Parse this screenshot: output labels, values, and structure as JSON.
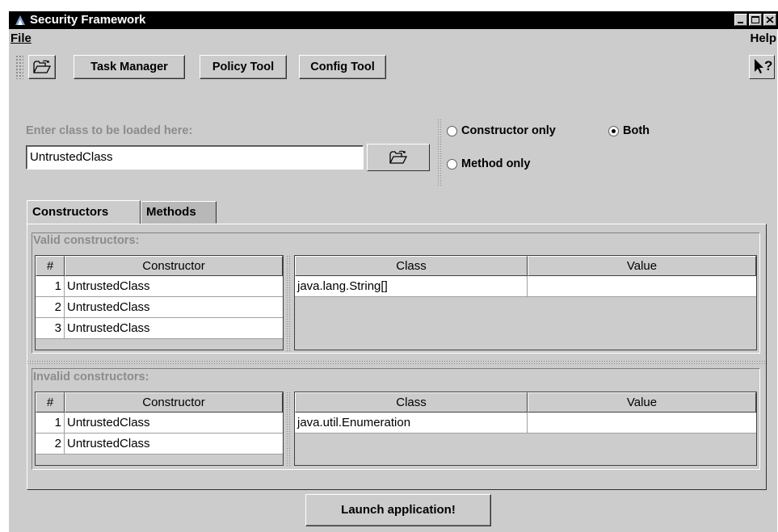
{
  "window": {
    "title": "Security Framework"
  },
  "menubar": {
    "file": "File",
    "help": "Help"
  },
  "toolbar": {
    "buttons": [
      "Task Manager",
      "Policy Tool",
      "Config Tool"
    ],
    "open_icon": "open-folder-icon",
    "help_icon": "help-pointer-icon"
  },
  "class_loader": {
    "label": "Enter class to be loaded here:",
    "value": "UntrustedClass",
    "browse_icon": "open-folder-icon"
  },
  "mode": {
    "options": [
      "Constructor only",
      "Both",
      "Method only"
    ],
    "selected": "Both"
  },
  "tabs": [
    {
      "label": "Constructors",
      "active": true
    },
    {
      "label": "Methods",
      "active": false
    }
  ],
  "valid": {
    "label": "Valid constructors:",
    "left_headers": [
      "#",
      "Constructor"
    ],
    "rows": [
      {
        "num": "1",
        "name": "UntrustedClass"
      },
      {
        "num": "2",
        "name": "UntrustedClass"
      },
      {
        "num": "3",
        "name": "UntrustedClass"
      }
    ],
    "right_headers": [
      "Class",
      "Value"
    ],
    "params": [
      {
        "class": "java.lang.String[]",
        "value": ""
      }
    ]
  },
  "invalid": {
    "label": "Invalid constructors:",
    "left_headers": [
      "#",
      "Constructor"
    ],
    "rows": [
      {
        "num": "1",
        "name": "UntrustedClass"
      },
      {
        "num": "2",
        "name": "UntrustedClass"
      }
    ],
    "right_headers": [
      "Class",
      "Value"
    ],
    "params": [
      {
        "class": "java.util.Enumeration",
        "value": ""
      }
    ]
  },
  "launch": {
    "label": "Launch application!"
  }
}
